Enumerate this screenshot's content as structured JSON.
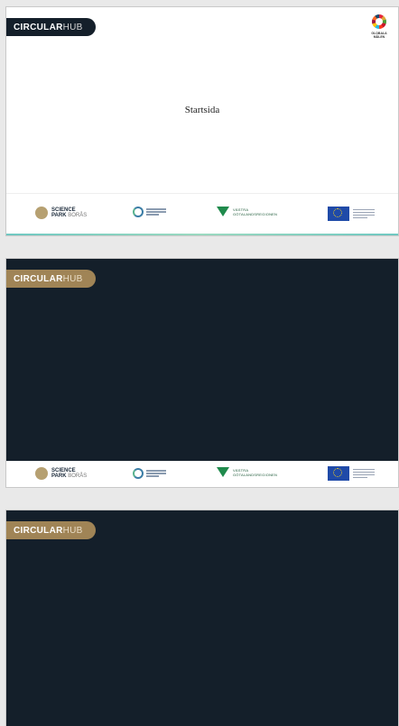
{
  "slides": [
    {
      "theme": "light",
      "badge": {
        "bold": "CIRCULAR",
        "thin": "HUB"
      },
      "title": "Startsida",
      "sdg_text": "GLOBALA MÅLEN",
      "footer": {
        "science_park": {
          "line1": "SCIENCE",
          "line2_bold": "PARK",
          "line2_thin": "BORÅS"
        },
        "vastra": {
          "line1": "VÄSTRA",
          "line2": "GÖTALANDSREGIONEN"
        }
      }
    },
    {
      "theme": "dark",
      "badge": {
        "bold": "CIRCULAR",
        "thin": "HUB"
      },
      "footer": {
        "science_park": {
          "line1": "SCIENCE",
          "line2_bold": "PARK",
          "line2_thin": "BORÅS"
        },
        "vastra": {
          "line1": "VÄSTRA",
          "line2": "GÖTALANDSREGIONEN"
        }
      }
    },
    {
      "theme": "dark",
      "badge": {
        "bold": "CIRCULAR",
        "thin": "HUB"
      }
    }
  ],
  "colors": {
    "navy": "#141f2a",
    "gold": "#a08456",
    "panel_bg": "#e9e9e9"
  }
}
